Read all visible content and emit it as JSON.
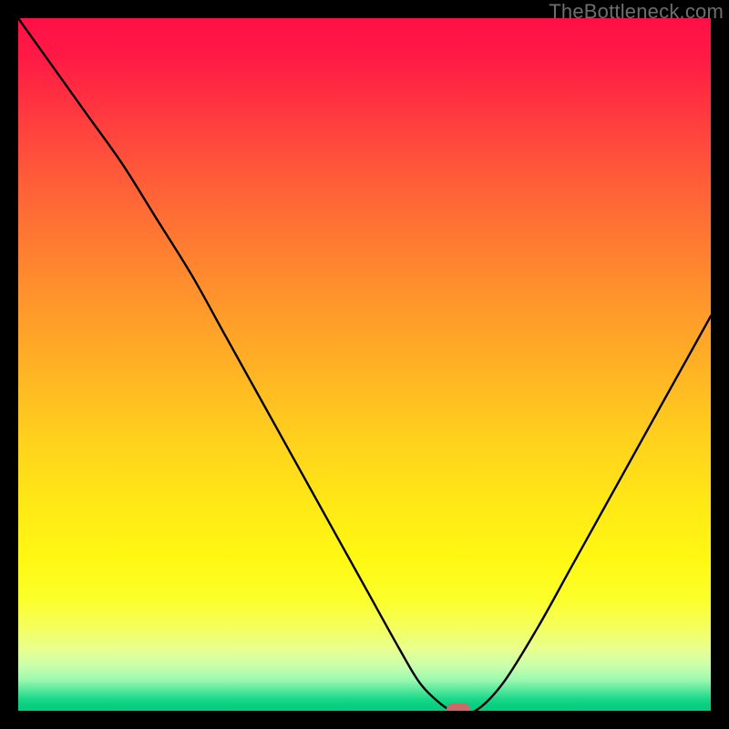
{
  "watermark": "TheBottleneck.com",
  "colors": {
    "frame": "#000000",
    "curve": "#000000",
    "marker": "#cc6a6a"
  },
  "chart_data": {
    "type": "line",
    "title": "",
    "xlabel": "",
    "ylabel": "",
    "xlim": [
      0,
      100
    ],
    "ylim": [
      0,
      100
    ],
    "grid": false,
    "legend": false,
    "annotations": [
      {
        "text": "TheBottleneck.com",
        "pos": "top-right"
      }
    ],
    "marker": {
      "x": 63.5,
      "y": 0
    },
    "background_gradient": [
      {
        "stop": 0,
        "color": "#ff1046"
      },
      {
        "stop": 22,
        "color": "#ff583a"
      },
      {
        "stop": 46,
        "color": "#ffa528"
      },
      {
        "stop": 70,
        "color": "#ffe816"
      },
      {
        "stop": 88,
        "color": "#f4ff5e"
      },
      {
        "stop": 95,
        "color": "#9cf9b0"
      },
      {
        "stop": 100,
        "color": "#04cd7d"
      }
    ],
    "series": [
      {
        "name": "bottleneck-curve",
        "x": [
          0,
          5,
          10,
          15,
          20,
          25,
          30,
          35,
          40,
          45,
          50,
          55,
          58,
          61,
          63,
          66,
          70,
          75,
          80,
          85,
          90,
          95,
          100
        ],
        "y": [
          100,
          93,
          86,
          79,
          71,
          63,
          54,
          45,
          36,
          27,
          18,
          9,
          4,
          1,
          0,
          0,
          4,
          12,
          21,
          30,
          39,
          48,
          57
        ]
      }
    ]
  }
}
